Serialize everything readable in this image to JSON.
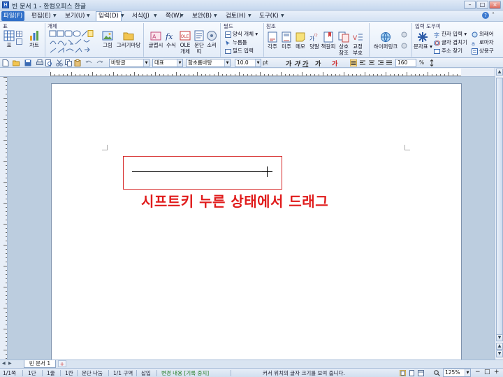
{
  "window": {
    "title": "빈 문서 1 - 한컴오피스 한글",
    "minimize": "–",
    "maximize": "□",
    "close": "×"
  },
  "menu": [
    {
      "label": "파일(F)"
    },
    {
      "label": "편집(E)"
    },
    {
      "label": "보기(U)"
    },
    {
      "label": "입력(D)"
    },
    {
      "label": "서식(J)"
    },
    {
      "label": "쪽(W)"
    },
    {
      "label": "보안(B)"
    },
    {
      "label": "검토(H)"
    },
    {
      "label": "도구(K)"
    }
  ],
  "ribbon": {
    "groups": {
      "table": "표",
      "object": "개체",
      "field": "필드",
      "reference": "참조",
      "input_tools": "입력 도우미"
    },
    "buttons": {
      "table": "표",
      "chart": "차트",
      "picture": "그림",
      "drawing": "그리기마당",
      "equation_editor": "글맵시",
      "formula": "수식",
      "ole": "OLE",
      "ole2": "개체",
      "paragraph": "문단",
      "paragraph2": "띠",
      "sound": "소리",
      "footnote": "각주",
      "endnote": "미주",
      "memo": "메모",
      "annotation": "덧말",
      "bookmark": "책갈피",
      "cross_ref": "상호",
      "cross_ref2": "참조",
      "correction": "교정",
      "correction2": "부호",
      "hyperlink": "하이퍼링크",
      "char_table": "문자표"
    },
    "field_items": {
      "form_object": "양식 개체",
      "click_here": "누름틀",
      "field_input": "필드 입력"
    },
    "helper_items": {
      "hanja_input": "한자 입력",
      "foreign": "외래어",
      "char_overlap": "글자 겹치기",
      "roman": "로마자",
      "find_address": "주소 찾기",
      "frequent": "상용구"
    }
  },
  "format_bar": {
    "style": "바탕글",
    "lang": "대표",
    "font": "함초롬바탕",
    "size": "10.0",
    "size_unit": "pt",
    "line_spacing": "160",
    "line_spacing_unit": "%",
    "bold": "가",
    "italic": "가",
    "underline": "가",
    "strike": "가",
    "color": "가"
  },
  "document": {
    "annotation": "시프트키 누른 상태에서 드래그",
    "annotation_color": "#e01b1b",
    "box_color": "#d62828"
  },
  "tab": {
    "doc_tab": "빈 문서 1",
    "add": "+"
  },
  "status": {
    "page": "1/1쪽",
    "section_col": "1단",
    "line": "1줄",
    "column": "1칸",
    "paragraph_break": "문단 나눔",
    "section": "1/1 구역",
    "insert": "삽입",
    "track_changes": "변경 내용 [기록 중지]",
    "hint": "커서 위치의 글자 크기를 보여 줍니다.",
    "zoom": "125%"
  }
}
